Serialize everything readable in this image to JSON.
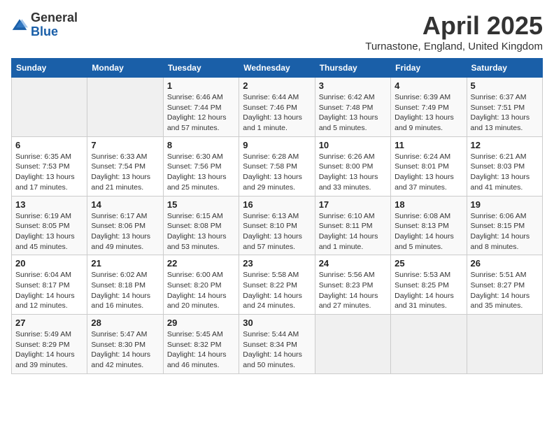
{
  "logo": {
    "general": "General",
    "blue": "Blue"
  },
  "header": {
    "month": "April 2025",
    "location": "Turnastone, England, United Kingdom"
  },
  "weekdays": [
    "Sunday",
    "Monday",
    "Tuesday",
    "Wednesday",
    "Thursday",
    "Friday",
    "Saturday"
  ],
  "weeks": [
    [
      {
        "day": "",
        "info": ""
      },
      {
        "day": "",
        "info": ""
      },
      {
        "day": "1",
        "info": "Sunrise: 6:46 AM\nSunset: 7:44 PM\nDaylight: 12 hours and 57 minutes."
      },
      {
        "day": "2",
        "info": "Sunrise: 6:44 AM\nSunset: 7:46 PM\nDaylight: 13 hours and 1 minute."
      },
      {
        "day": "3",
        "info": "Sunrise: 6:42 AM\nSunset: 7:48 PM\nDaylight: 13 hours and 5 minutes."
      },
      {
        "day": "4",
        "info": "Sunrise: 6:39 AM\nSunset: 7:49 PM\nDaylight: 13 hours and 9 minutes."
      },
      {
        "day": "5",
        "info": "Sunrise: 6:37 AM\nSunset: 7:51 PM\nDaylight: 13 hours and 13 minutes."
      }
    ],
    [
      {
        "day": "6",
        "info": "Sunrise: 6:35 AM\nSunset: 7:53 PM\nDaylight: 13 hours and 17 minutes."
      },
      {
        "day": "7",
        "info": "Sunrise: 6:33 AM\nSunset: 7:54 PM\nDaylight: 13 hours and 21 minutes."
      },
      {
        "day": "8",
        "info": "Sunrise: 6:30 AM\nSunset: 7:56 PM\nDaylight: 13 hours and 25 minutes."
      },
      {
        "day": "9",
        "info": "Sunrise: 6:28 AM\nSunset: 7:58 PM\nDaylight: 13 hours and 29 minutes."
      },
      {
        "day": "10",
        "info": "Sunrise: 6:26 AM\nSunset: 8:00 PM\nDaylight: 13 hours and 33 minutes."
      },
      {
        "day": "11",
        "info": "Sunrise: 6:24 AM\nSunset: 8:01 PM\nDaylight: 13 hours and 37 minutes."
      },
      {
        "day": "12",
        "info": "Sunrise: 6:21 AM\nSunset: 8:03 PM\nDaylight: 13 hours and 41 minutes."
      }
    ],
    [
      {
        "day": "13",
        "info": "Sunrise: 6:19 AM\nSunset: 8:05 PM\nDaylight: 13 hours and 45 minutes."
      },
      {
        "day": "14",
        "info": "Sunrise: 6:17 AM\nSunset: 8:06 PM\nDaylight: 13 hours and 49 minutes."
      },
      {
        "day": "15",
        "info": "Sunrise: 6:15 AM\nSunset: 8:08 PM\nDaylight: 13 hours and 53 minutes."
      },
      {
        "day": "16",
        "info": "Sunrise: 6:13 AM\nSunset: 8:10 PM\nDaylight: 13 hours and 57 minutes."
      },
      {
        "day": "17",
        "info": "Sunrise: 6:10 AM\nSunset: 8:11 PM\nDaylight: 14 hours and 1 minute."
      },
      {
        "day": "18",
        "info": "Sunrise: 6:08 AM\nSunset: 8:13 PM\nDaylight: 14 hours and 5 minutes."
      },
      {
        "day": "19",
        "info": "Sunrise: 6:06 AM\nSunset: 8:15 PM\nDaylight: 14 hours and 8 minutes."
      }
    ],
    [
      {
        "day": "20",
        "info": "Sunrise: 6:04 AM\nSunset: 8:17 PM\nDaylight: 14 hours and 12 minutes."
      },
      {
        "day": "21",
        "info": "Sunrise: 6:02 AM\nSunset: 8:18 PM\nDaylight: 14 hours and 16 minutes."
      },
      {
        "day": "22",
        "info": "Sunrise: 6:00 AM\nSunset: 8:20 PM\nDaylight: 14 hours and 20 minutes."
      },
      {
        "day": "23",
        "info": "Sunrise: 5:58 AM\nSunset: 8:22 PM\nDaylight: 14 hours and 24 minutes."
      },
      {
        "day": "24",
        "info": "Sunrise: 5:56 AM\nSunset: 8:23 PM\nDaylight: 14 hours and 27 minutes."
      },
      {
        "day": "25",
        "info": "Sunrise: 5:53 AM\nSunset: 8:25 PM\nDaylight: 14 hours and 31 minutes."
      },
      {
        "day": "26",
        "info": "Sunrise: 5:51 AM\nSunset: 8:27 PM\nDaylight: 14 hours and 35 minutes."
      }
    ],
    [
      {
        "day": "27",
        "info": "Sunrise: 5:49 AM\nSunset: 8:29 PM\nDaylight: 14 hours and 39 minutes."
      },
      {
        "day": "28",
        "info": "Sunrise: 5:47 AM\nSunset: 8:30 PM\nDaylight: 14 hours and 42 minutes."
      },
      {
        "day": "29",
        "info": "Sunrise: 5:45 AM\nSunset: 8:32 PM\nDaylight: 14 hours and 46 minutes."
      },
      {
        "day": "30",
        "info": "Sunrise: 5:44 AM\nSunset: 8:34 PM\nDaylight: 14 hours and 50 minutes."
      },
      {
        "day": "",
        "info": ""
      },
      {
        "day": "",
        "info": ""
      },
      {
        "day": "",
        "info": ""
      }
    ]
  ]
}
